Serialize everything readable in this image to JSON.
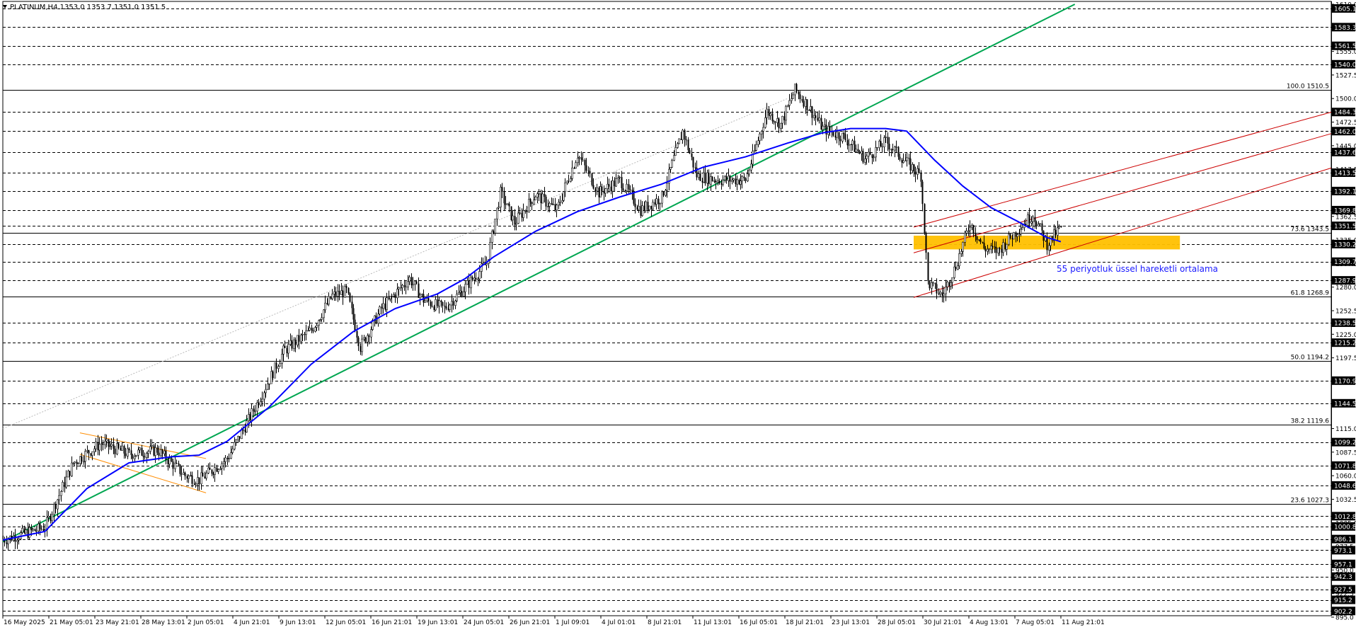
{
  "header": {
    "symbol": "PLATINUM,H4",
    "ohlc": "1353.0 1353.7 1351.0 1351.5"
  },
  "annotation": "55 periyotluk üssel hareketli ortalama",
  "colors": {
    "background": "#ffffff",
    "candle": "#000000",
    "ema": "#0000ff",
    "trendline": "#00a651",
    "fib_lines": "#000000",
    "channel_red": "#cc0000",
    "channel_orange": "#ff8c00",
    "zone": "#ffc000",
    "annotation_text": "#1a1aff",
    "axis_label_bg": "#000000",
    "axis_label_fg": "#ffffff"
  },
  "chart_data": {
    "type": "candlestick",
    "ylim": [
      895.0,
      1610.0
    ],
    "y_ticks": [
      "1610.0",
      "1582.5",
      "1555.0",
      "1527.5",
      "1500.0",
      "1472.5",
      "1445.0",
      "1417.5",
      "1390.0",
      "1362.5",
      "1335.0",
      "1307.5",
      "1280.0",
      "1252.5",
      "1225.0",
      "1197.5",
      "1170.0",
      "1142.5",
      "1115.0",
      "1087.5",
      "1060.0",
      "1032.5",
      "1005.0",
      "977.5",
      "950.0",
      "922.5",
      "895.0"
    ],
    "price_labels": [
      {
        "text": "1605.1",
        "value": 1605.1
      },
      {
        "text": "1583.3",
        "value": 1583.3
      },
      {
        "text": "1561.5",
        "value": 1561.5
      },
      {
        "text": "1540.0",
        "value": 1540.0
      },
      {
        "text": "1484.3",
        "value": 1484.3
      },
      {
        "text": "1462.0",
        "value": 1462.0
      },
      {
        "text": "1437.6",
        "value": 1437.6
      },
      {
        "text": "1413.5",
        "value": 1413.5
      },
      {
        "text": "1392.1",
        "value": 1392.1
      },
      {
        "text": "1369.8",
        "value": 1369.8
      },
      {
        "text": "1351.5",
        "value": 1351.5
      },
      {
        "text": "1330.2",
        "value": 1330.2
      },
      {
        "text": "1309.7",
        "value": 1309.7
      },
      {
        "text": "1287.9",
        "value": 1287.9
      },
      {
        "text": "1238.5",
        "value": 1238.5
      },
      {
        "text": "1215.2",
        "value": 1215.2
      },
      {
        "text": "1170.9",
        "value": 1170.9
      },
      {
        "text": "1144.5",
        "value": 1144.5
      },
      {
        "text": "1099.2",
        "value": 1099.2
      },
      {
        "text": "1071.8",
        "value": 1071.8
      },
      {
        "text": "1048.6",
        "value": 1048.6
      },
      {
        "text": "1012.8",
        "value": 1012.8
      },
      {
        "text": "1000.8",
        "value": 1000.8
      },
      {
        "text": "986.1",
        "value": 986.1
      },
      {
        "text": "973.1",
        "value": 973.1
      },
      {
        "text": "957.1",
        "value": 957.1
      },
      {
        "text": "942.3",
        "value": 942.3
      },
      {
        "text": "927.5",
        "value": 927.5
      },
      {
        "text": "915.2",
        "value": 915.2
      },
      {
        "text": "902.2",
        "value": 902.2
      }
    ],
    "fib_levels": [
      {
        "text": "100.0 1510.5",
        "value": 1510.5
      },
      {
        "text": "73.6 1343.5",
        "value": 1343.5
      },
      {
        "text": "61.8 1268.9",
        "value": 1268.9
      },
      {
        "text": "50.0 1194.2",
        "value": 1194.2
      },
      {
        "text": "38.2 1119.6",
        "value": 1119.6
      },
      {
        "text": "23.6 1027.3",
        "value": 1027.3
      }
    ],
    "x_labels": [
      "16 May 2025",
      "21 May 05:01",
      "23 May 21:01",
      "28 May 13:01",
      "2 Jun 05:01",
      "4 Jun 21:01",
      "9 Jun 13:01",
      "12 Jun 05:01",
      "16 Jun 21:01",
      "19 Jun 13:01",
      "24 Jun 05:01",
      "26 Jun 21:01",
      "1 Jul 09:01",
      "4 Jul 01:01",
      "8 Jul 21:01",
      "11 Jul 13:01",
      "16 Jul 05:01",
      "18 Jul 21:01",
      "23 Jul 13:01",
      "28 Jul 05:01",
      "30 Jul 21:01",
      "4 Aug 13:01",
      "7 Aug 05:01",
      "11 Aug 21:01"
    ],
    "price_path": [
      [
        0,
        985
      ],
      [
        6,
        1000
      ],
      [
        10,
        1075
      ],
      [
        14,
        1098
      ],
      [
        18,
        1085
      ],
      [
        22,
        1090
      ],
      [
        26,
        1060
      ],
      [
        28,
        1055
      ],
      [
        32,
        1080
      ],
      [
        36,
        1140
      ],
      [
        40,
        1205
      ],
      [
        44,
        1230
      ],
      [
        47,
        1270
      ],
      [
        49,
        1275
      ],
      [
        51,
        1210
      ],
      [
        54,
        1255
      ],
      [
        58,
        1290
      ],
      [
        60,
        1265
      ],
      [
        63,
        1255
      ],
      [
        66,
        1280
      ],
      [
        69,
        1308
      ],
      [
        71,
        1390
      ],
      [
        73,
        1355
      ],
      [
        76,
        1388
      ],
      [
        79,
        1370
      ],
      [
        82,
        1435
      ],
      [
        85,
        1390
      ],
      [
        88,
        1405
      ],
      [
        91,
        1370
      ],
      [
        94,
        1385
      ],
      [
        97,
        1462
      ],
      [
        99,
        1410
      ],
      [
        102,
        1405
      ],
      [
        106,
        1405
      ],
      [
        109,
        1485
      ],
      [
        111,
        1470
      ],
      [
        113,
        1510
      ],
      [
        115,
        1490
      ],
      [
        117,
        1465
      ],
      [
        120,
        1455
      ],
      [
        123,
        1430
      ],
      [
        126,
        1450
      ],
      [
        129,
        1425
      ],
      [
        131,
        1410
      ],
      [
        132,
        1285
      ],
      [
        134,
        1270
      ],
      [
        136,
        1305
      ],
      [
        138,
        1355
      ],
      [
        140,
        1325
      ],
      [
        142,
        1322
      ],
      [
        144,
        1340
      ],
      [
        147,
        1365
      ],
      [
        149,
        1330
      ],
      [
        151,
        1350
      ]
    ],
    "ema_path": [
      [
        0,
        985
      ],
      [
        6,
        995
      ],
      [
        12,
        1045
      ],
      [
        18,
        1075
      ],
      [
        24,
        1082
      ],
      [
        28,
        1084
      ],
      [
        32,
        1100
      ],
      [
        38,
        1140
      ],
      [
        44,
        1190
      ],
      [
        50,
        1228
      ],
      [
        56,
        1255
      ],
      [
        62,
        1272
      ],
      [
        66,
        1290
      ],
      [
        70,
        1315
      ],
      [
        76,
        1345
      ],
      [
        82,
        1368
      ],
      [
        88,
        1385
      ],
      [
        94,
        1400
      ],
      [
        100,
        1420
      ],
      [
        106,
        1432
      ],
      [
        112,
        1448
      ],
      [
        117,
        1460
      ],
      [
        121,
        1465
      ],
      [
        126,
        1465
      ],
      [
        129,
        1462
      ],
      [
        133,
        1428
      ],
      [
        137,
        1398
      ],
      [
        141,
        1373
      ],
      [
        145,
        1356
      ],
      [
        149,
        1338
      ],
      [
        151,
        1333
      ]
    ],
    "trendline": [
      [
        0,
        983
      ],
      [
        153,
        1610
      ]
    ],
    "channel_red": [
      {
        "from": [
          130,
          1350
        ],
        "to": [
          190,
          1485
        ]
      },
      {
        "from": [
          130,
          1320
        ],
        "to": [
          190,
          1460
        ]
      },
      {
        "from": [
          130,
          1268
        ],
        "to": [
          190,
          1420
        ]
      }
    ],
    "channel_orange": [
      {
        "from": [
          11,
          1110
        ],
        "to": [
          29,
          1080
        ]
      },
      {
        "from": [
          11,
          1085
        ],
        "to": [
          29,
          1040
        ]
      }
    ],
    "zone": {
      "x_from": 130,
      "x_to": 168,
      "y_from": 1324,
      "y_to": 1340
    },
    "dotted_line": {
      "from": [
        0,
        1115
      ],
      "to": [
        112,
        1500
      ]
    }
  }
}
